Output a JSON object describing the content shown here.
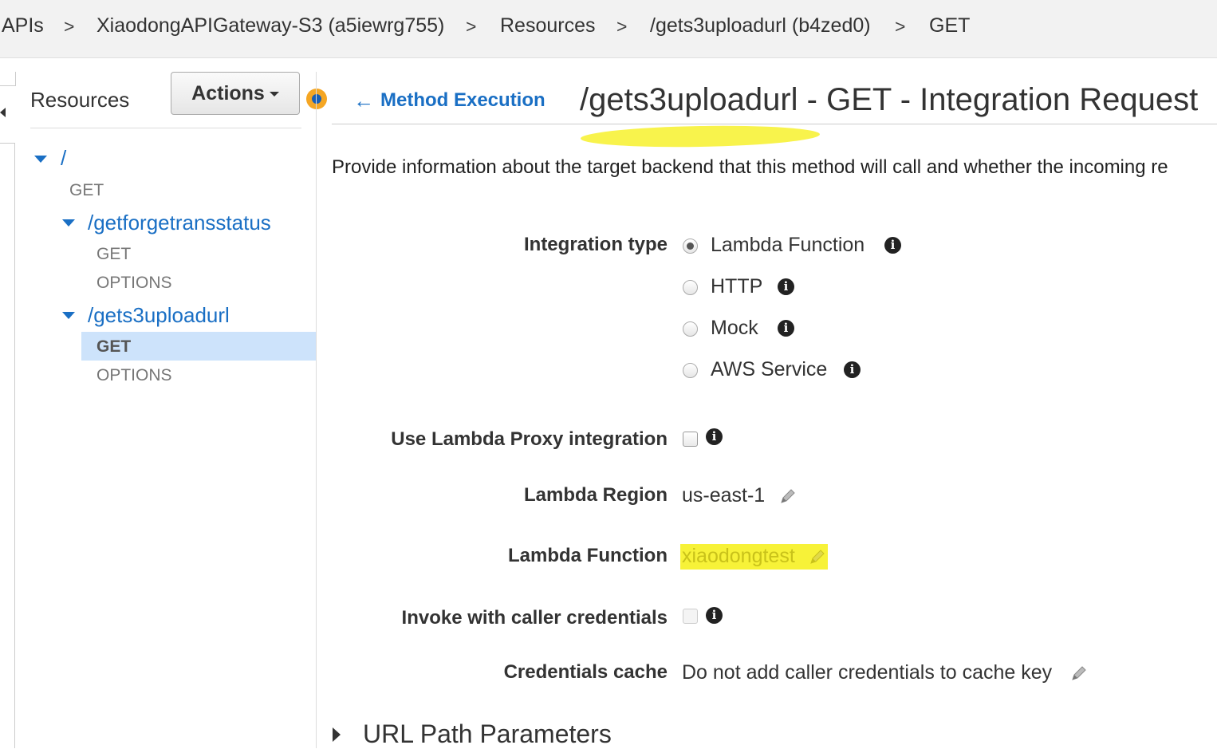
{
  "breadcrumb": {
    "items": [
      "APIs",
      "XiaodongAPIGateway-S3 (a5iewrg755)",
      "Resources",
      "/gets3uploadurl (b4zed0)",
      "GET"
    ],
    "separator": ">"
  },
  "resources_panel": {
    "title": "Resources",
    "actions_label": "Actions",
    "tree": {
      "root": {
        "path": "/",
        "methods": [
          "GET"
        ]
      },
      "children": [
        {
          "path": "/getforgetransstatus",
          "methods": [
            "GET",
            "OPTIONS"
          ]
        },
        {
          "path": "/gets3uploadurl",
          "methods": [
            "GET",
            "OPTIONS"
          ],
          "selected_method": "GET"
        }
      ]
    }
  },
  "main": {
    "back_link": "Method Execution",
    "title": "/gets3uploadurl - GET - Integration Request",
    "description": "Provide information about the target backend that this method will call and whether the incoming re"
  },
  "form": {
    "integration_type": {
      "label": "Integration type",
      "options": [
        "Lambda Function",
        "HTTP",
        "Mock",
        "AWS Service"
      ],
      "selected": "Lambda Function"
    },
    "lambda_proxy": {
      "label": "Use Lambda Proxy integration",
      "checked": false
    },
    "lambda_region": {
      "label": "Lambda Region",
      "value": "us-east-1"
    },
    "lambda_function": {
      "label": "Lambda Function",
      "value": "xiaodongtest"
    },
    "invoke_credentials": {
      "label": "Invoke with caller credentials",
      "checked": false
    },
    "credentials_cache": {
      "label": "Credentials cache",
      "value": "Do not add caller credentials to cache key"
    }
  },
  "sections": {
    "url_path_parameters": "URL Path Parameters"
  },
  "colors": {
    "link": "#1a6fc4",
    "highlight": "#f7f238",
    "selected_row": "#cde3fb",
    "status_dot": "#f5a623"
  },
  "icons": [
    "arrow-left-icon",
    "info-icon",
    "pencil-icon",
    "caret-down-icon",
    "triangle-down-icon",
    "triangle-right-icon"
  ]
}
